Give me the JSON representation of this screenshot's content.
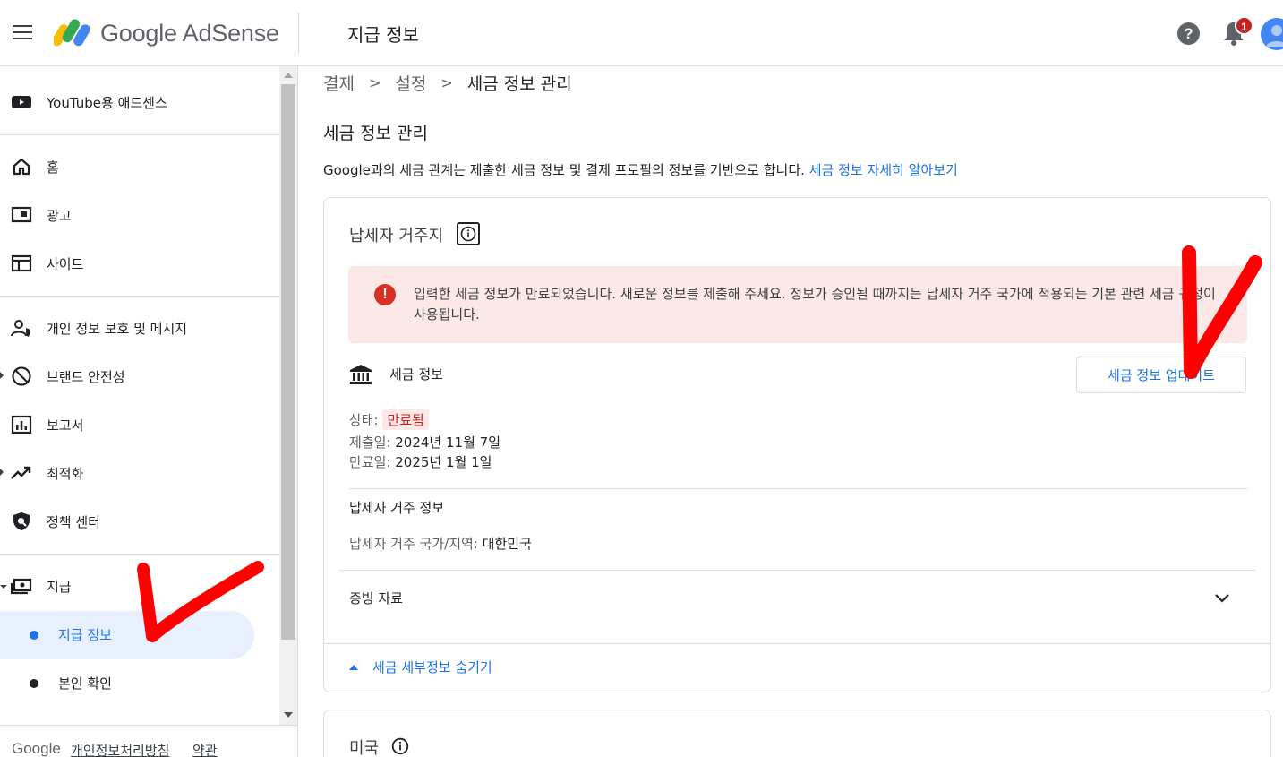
{
  "header": {
    "app_name": "Google AdSense",
    "page_title": "지급 정보",
    "notification_count": "1"
  },
  "sidebar": {
    "youtube": "YouTube용 애드센스",
    "items": [
      {
        "label": "홈"
      },
      {
        "label": "광고"
      },
      {
        "label": "사이트"
      },
      {
        "label": "개인 정보 보호 및 메시지"
      },
      {
        "label": "브랜드 안전성"
      },
      {
        "label": "보고서"
      },
      {
        "label": "최적화"
      },
      {
        "label": "정책 센터"
      },
      {
        "label": "지급"
      }
    ],
    "sub_items": [
      {
        "label": "지급 정보",
        "active": true
      },
      {
        "label": "본인 확인",
        "active": false
      }
    ]
  },
  "footer": {
    "google": "Google",
    "privacy": "개인정보처리방침",
    "terms": "약관"
  },
  "breadcrumb": [
    "결제",
    "설정",
    "세금 정보 관리"
  ],
  "main": {
    "title": "세금 정보 관리",
    "description": "Google과의 세금 관계는 제출한 세금 정보 및 결제 프로필의 정보를 기반으로 합니다.",
    "learn_more": "세금 정보 자세히 알아보기"
  },
  "card": {
    "title": "납세자 거주지",
    "alert": "입력한 세금 정보가 만료되었습니다. 새로운 정보를 제출해 주세요. 정보가 승인될 때까지는 납세자 거주 국가에 적용되는 기본 관련 세금 규정이 사용됩니다.",
    "tax_info_label": "세금 정보",
    "update_button": "세금 정보 업데이트",
    "status_key": "상태:",
    "status_value": "만료됨",
    "submitted_key": "제출일:",
    "submitted_value": "2024년 11월 7일",
    "expires_key": "만료일:",
    "expires_value": "2025년 1월 1일",
    "residence_head": "납세자 거주 정보",
    "residence_key": "납세자 거주 국가/지역:",
    "residence_value": "대한민국",
    "documents": "증빙 자료",
    "hide_details": "세금 세부정보 숨기기"
  },
  "card2": {
    "title": "미국"
  },
  "colors": {
    "accent": "#1a73e8",
    "error": "#d93025",
    "alert_bg": "#fce8e6",
    "annotation": "#ff0000"
  }
}
